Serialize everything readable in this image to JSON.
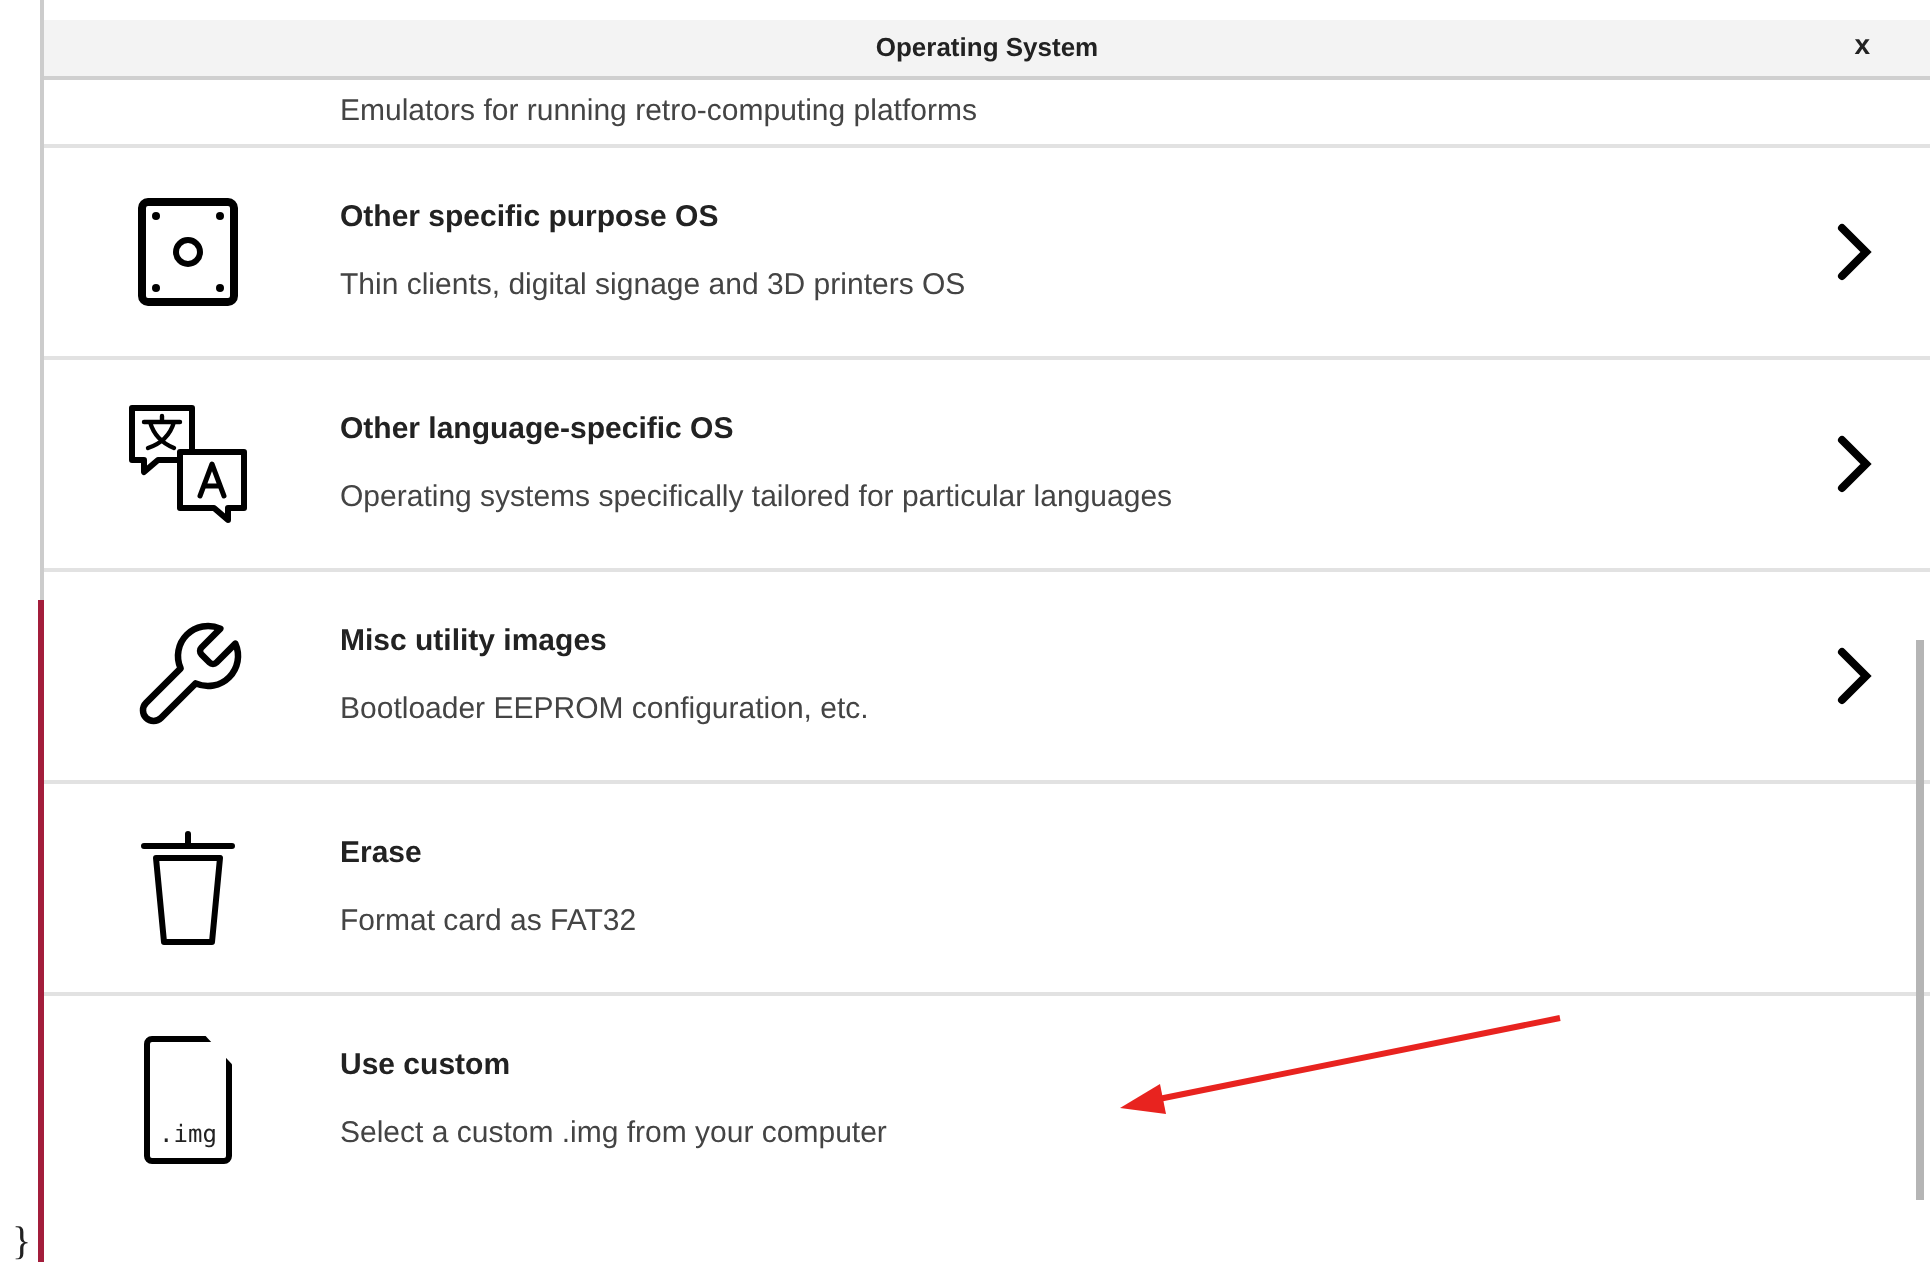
{
  "dialog": {
    "title": "Operating System",
    "close": "x"
  },
  "partial_item": {
    "description": "Emulators for running retro-computing platforms"
  },
  "items": [
    {
      "title": "Other specific purpose OS",
      "description": "Thin clients, digital signage and 3D printers OS",
      "chevron": true
    },
    {
      "title": "Other language-specific OS",
      "description": "Operating systems specifically tailored for particular languages",
      "chevron": true
    },
    {
      "title": "Misc utility images",
      "description": "Bootloader EEPROM configuration, etc.",
      "chevron": true
    },
    {
      "title": "Erase",
      "description": "Format card as FAT32",
      "chevron": false
    },
    {
      "title": "Use custom",
      "description": "Select a custom .img from your computer",
      "chevron": false,
      "icon_text": ".img"
    }
  ],
  "margin_text": "}"
}
